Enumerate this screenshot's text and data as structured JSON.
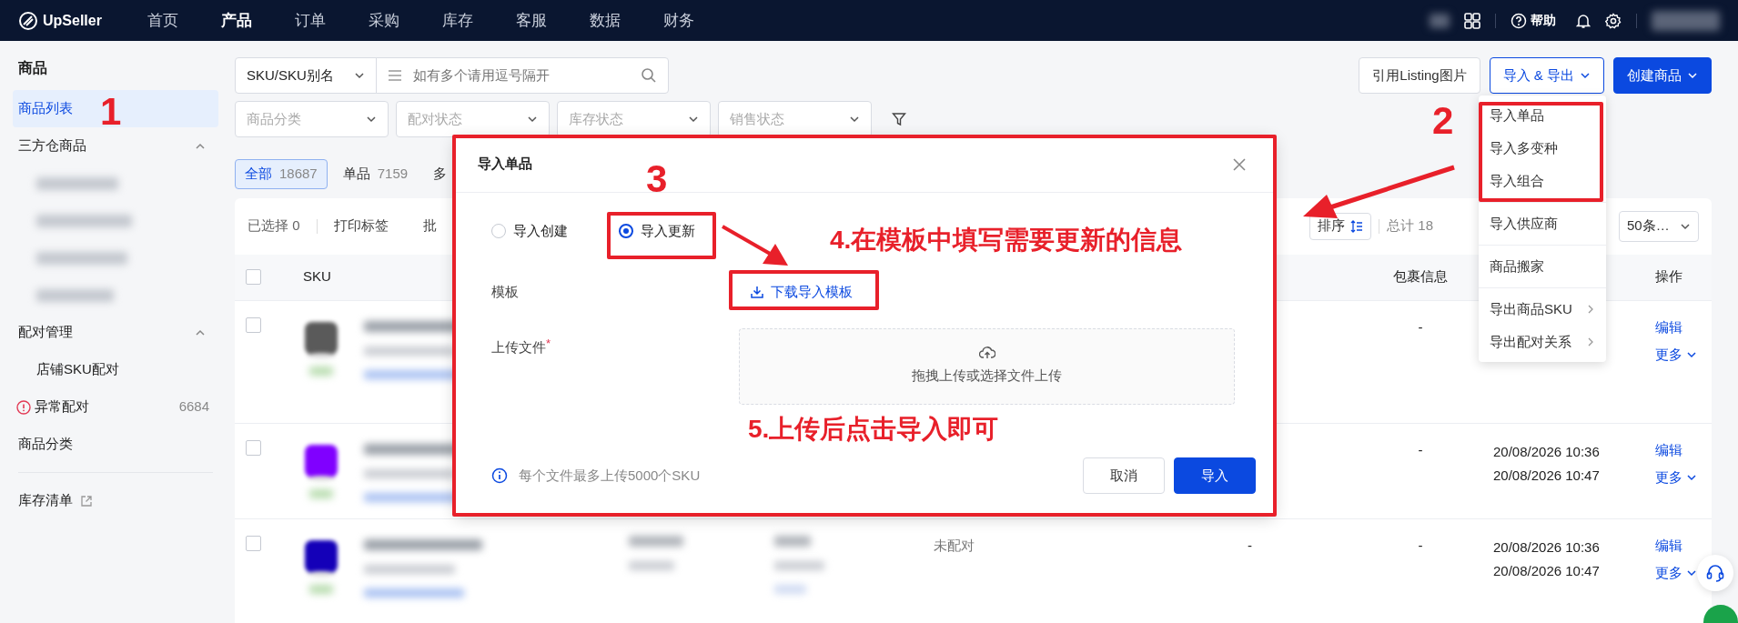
{
  "top_nav": {
    "logo": "UpSeller",
    "items": [
      {
        "label": "首页",
        "selected": false
      },
      {
        "label": "产品",
        "selected": true
      },
      {
        "label": "订单",
        "selected": false
      },
      {
        "label": "采购",
        "selected": false
      },
      {
        "label": "库存",
        "selected": false
      },
      {
        "label": "客服",
        "selected": false
      },
      {
        "label": "数据",
        "selected": false
      },
      {
        "label": "财务",
        "selected": false
      }
    ],
    "help": "帮助"
  },
  "sidebar": {
    "title": "商品",
    "items": [
      {
        "label": "商品列表",
        "kind": "link",
        "selected": true
      },
      {
        "label": "三方仓商品",
        "kind": "group",
        "expanded": true,
        "redacted_children": true,
        "selected": false
      },
      {
        "label": "配对管理",
        "kind": "group",
        "expanded": true,
        "selected": false,
        "children": [
          {
            "label": "店铺SKU配对",
            "selected": false
          }
        ]
      },
      {
        "label": "异常配对",
        "kind": "alert",
        "count": "6684",
        "selected": false
      },
      {
        "label": "商品分类",
        "kind": "link",
        "selected": false
      }
    ],
    "footer_links": [
      {
        "label": "库存清单",
        "external": true
      }
    ]
  },
  "search": {
    "field_select": "SKU/SKU别名",
    "placeholder": "如有多个请用逗号隔开"
  },
  "filters": [
    {
      "placeholder": "商品分类"
    },
    {
      "placeholder": "配对状态"
    },
    {
      "placeholder": "库存状态"
    },
    {
      "placeholder": "销售状态"
    }
  ],
  "header_buttons": [
    {
      "label": "引用Listing图片",
      "kind": "default",
      "dropdown": false
    },
    {
      "label": "导入 & 导出",
      "kind": "outline",
      "dropdown": true
    },
    {
      "label": "创建商品",
      "kind": "primary",
      "dropdown": true
    }
  ],
  "tabs": [
    {
      "label": "全部",
      "count": "18687",
      "selected": true
    },
    {
      "label": "单品",
      "count": "7159",
      "selected": false
    },
    {
      "label": "多",
      "selected": false
    }
  ],
  "toolbar": {
    "selected_label": "已选择 0",
    "actions": [
      "打印标签",
      "批"
    ],
    "sort": "排序",
    "total": "总计 18",
    "page_size": "50条…"
  },
  "table": {
    "header": {
      "sku": "SKU",
      "package": "包裹信息",
      "actions": "操作",
      "checked": false
    },
    "rows": [
      {
        "checked": false,
        "color": "#5a5a5a",
        "package": "-",
        "edit": "编辑",
        "more": "更多"
      },
      {
        "checked": false,
        "color": "#8000ff",
        "package": "-",
        "times": [
          "20/08/2026 10:36",
          "20/08/2026 10:47"
        ],
        "edit": "编辑",
        "more": "更多"
      },
      {
        "checked": false,
        "color": "#1400b8",
        "match_status": "未配对",
        "column_6": "-",
        "package": "-",
        "times": [
          "20/08/2026 10:36",
          "20/08/2026 10:47"
        ],
        "edit": "编辑",
        "more": "更多"
      }
    ]
  },
  "dropdown_menu": {
    "groups": [
      [
        {
          "label": "导入单品",
          "submenu": false
        },
        {
          "label": "导入多变种",
          "submenu": false
        },
        {
          "label": "导入组合",
          "submenu": false
        }
      ],
      [
        {
          "label": "导入供应商",
          "submenu": false
        }
      ],
      [
        {
          "label": "商品搬家",
          "submenu": false
        }
      ],
      [
        {
          "label": "导出商品SKU",
          "submenu": true
        },
        {
          "label": "导出配对关系",
          "submenu": true
        }
      ]
    ]
  },
  "modal": {
    "title": "导入单品",
    "options": [
      {
        "label": "导入创建",
        "selected": false
      },
      {
        "label": "导入更新",
        "selected": true
      }
    ],
    "template_label": "模板",
    "template_link": "下载导入模板",
    "upload_label": "上传文件",
    "required_mark": "*",
    "upload_hint": "拖拽上传或选择文件上传",
    "note": "每个文件最多上传5000个SKU",
    "buttons": [
      {
        "label": "取消",
        "kind": "secondary"
      },
      {
        "label": "导入",
        "kind": "primary"
      }
    ]
  },
  "annotations": [
    {
      "kind": "number",
      "text": "1"
    },
    {
      "kind": "number",
      "text": "2"
    },
    {
      "kind": "number",
      "text": "3"
    },
    {
      "kind": "note",
      "text": "4.在模板中填写需要更新的信息"
    },
    {
      "kind": "note",
      "text": "5.上传后点击导入即可"
    }
  ]
}
